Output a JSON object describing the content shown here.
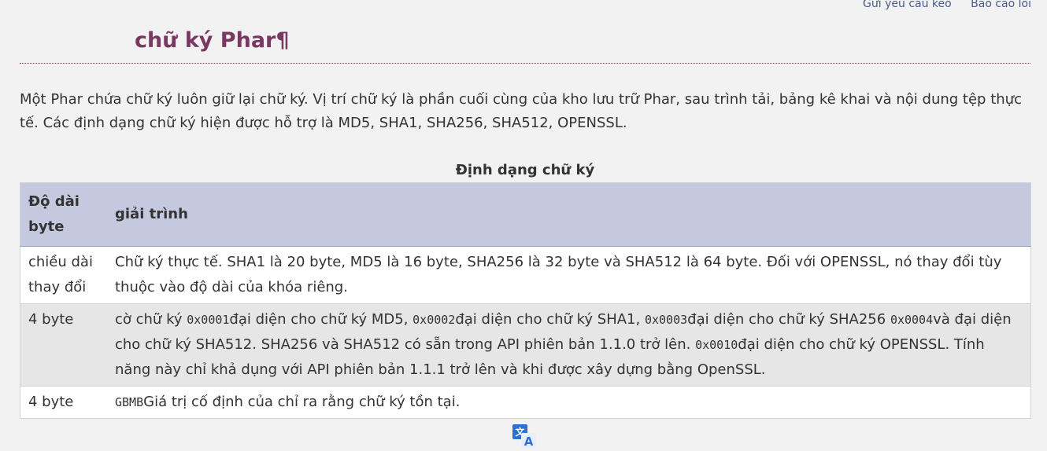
{
  "header": {
    "edit_link": "Gửi yêu cầu kéo",
    "report_link": "Báo cáo lỗi"
  },
  "page_title": "chữ ký Phar¶",
  "intro": "Một Phar chứa chữ ký luôn giữ lại chữ ký. Vị trí chữ ký là phần cuối cùng của kho lưu trữ Phar, sau trình tải, bảng kê khai và nội dung tệp thực tế. Các định dạng chữ ký hiện được hỗ trợ là MD5, SHA1, SHA256, SHA512, OPENSSL.",
  "table": {
    "caption": "Định dạng chữ ký",
    "headers": [
      "Độ dài byte",
      "giải trình"
    ],
    "rows": [
      {
        "length": "chiều dài thay đổi",
        "desc": "Chữ ký thực tế. SHA1 là 20 byte, MD5 là 16 byte, SHA256 là 32 byte và SHA512 là 64 byte. Đối với OPENSSL, nó thay đổi tùy thuộc vào độ dài của khóa riêng."
      },
      {
        "length": "4 byte",
        "prefix": "cờ chữ ký ",
        "c1": "0x0001",
        "t1": "đại diện cho chữ ký MD5, ",
        "c2": "0x0002",
        "t2": "đại diện cho chữ ký SHA1, ",
        "c3": "0x0003",
        "t3": "đại diện cho chữ ký SHA256 ",
        "c4": "0x0004",
        "t4": "và đại diện cho chữ ký SHA512. SHA256 và SHA512 có sẵn trong API phiên bản 1.1.0 trở lên. ",
        "c5": "0x0010",
        "t5": "đại diện cho chữ ký OPENSSL. Tính năng này chỉ khả dụng với API phiên bản 1.1.1 trở lên và khi được xây dựng bằng OpenSSL."
      },
      {
        "length": "4 byte",
        "code": "GBMB",
        "text": "Giá trị cố định của chỉ ra rằng chữ ký tồn tại."
      }
    ]
  },
  "colors": {
    "title": "#793862",
    "table_header": "#c4c9df",
    "link": "#4a5a8c",
    "translate_icon": "#2d6fd2"
  },
  "icons": {
    "translate": "translate-icon"
  }
}
